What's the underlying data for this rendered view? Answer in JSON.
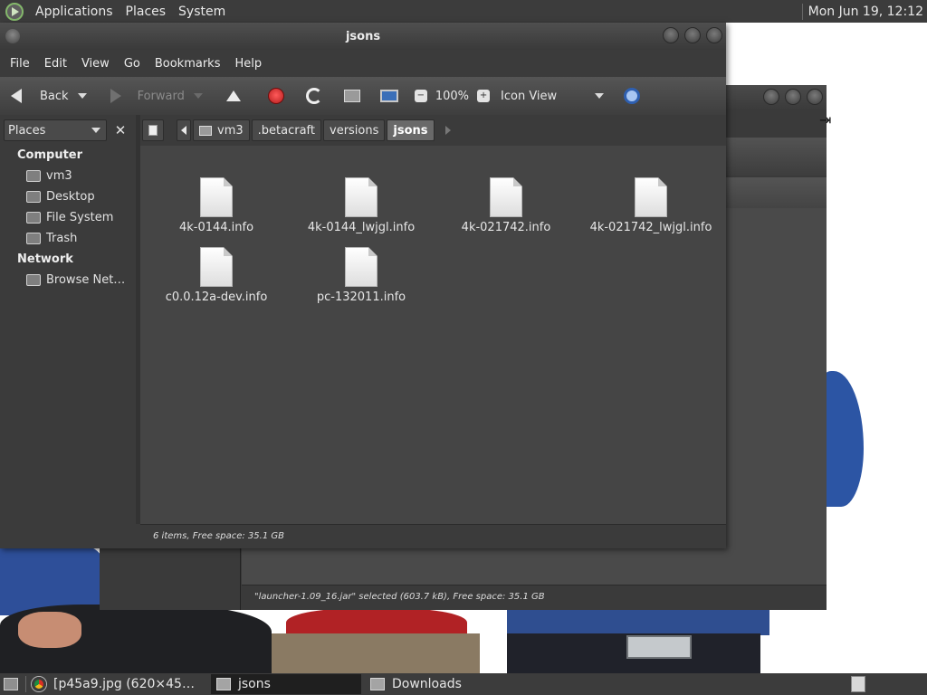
{
  "top_panel": {
    "menus": [
      "Applications",
      "Places",
      "System"
    ],
    "clock": "Mon Jun 19, 12:12"
  },
  "window": {
    "title": "jsons",
    "menubar": [
      "File",
      "Edit",
      "View",
      "Go",
      "Bookmarks",
      "Help"
    ],
    "toolbar": {
      "back_label": "Back",
      "forward_label": "Forward",
      "zoom": "100%",
      "view_mode": "Icon View"
    },
    "sidebar": {
      "selector_label": "Places",
      "sections": [
        {
          "title": "Computer",
          "items": [
            {
              "label": "vm3",
              "icon": "home-folder-icon"
            },
            {
              "label": "Desktop",
              "icon": "desktop-icon"
            },
            {
              "label": "File System",
              "icon": "drive-icon"
            },
            {
              "label": "Trash",
              "icon": "trash-icon"
            }
          ]
        },
        {
          "title": "Network",
          "items": [
            {
              "label": "Browse Net…",
              "icon": "network-icon"
            }
          ]
        }
      ]
    },
    "path": [
      "vm3",
      ".betacraft",
      "versions",
      "jsons"
    ],
    "files": [
      {
        "name": "4k-0144.info",
        "icon": "text-file-icon"
      },
      {
        "name": "4k-0144_lwjgl.info",
        "icon": "text-file-icon"
      },
      {
        "name": "4k-021742.info",
        "icon": "text-file-icon"
      },
      {
        "name": "4k-021742_lwjgl.info",
        "icon": "text-file-icon"
      },
      {
        "name": "c0.0.12a-dev.info",
        "icon": "text-file-icon"
      },
      {
        "name": "pc-132011.info",
        "icon": "text-file-icon"
      }
    ],
    "status": "6 items, Free space: 35.1 GB"
  },
  "background_window": {
    "status": "\"launcher-1.09_16.jar\" selected (603.7 kB), Free space: 35.1 GB"
  },
  "taskbar": {
    "tasks": [
      {
        "label": "[p45a9.jpg (620×45…",
        "icon": "chrome-icon",
        "active": false
      },
      {
        "label": "jsons",
        "icon": "folder-icon",
        "active": true
      },
      {
        "label": "Downloads",
        "icon": "folder-icon",
        "active": false
      }
    ]
  },
  "colors": {
    "panel": "#3c3c3c",
    "window": "#3b3b3b",
    "content": "#454545",
    "accent": "#84b86b"
  }
}
